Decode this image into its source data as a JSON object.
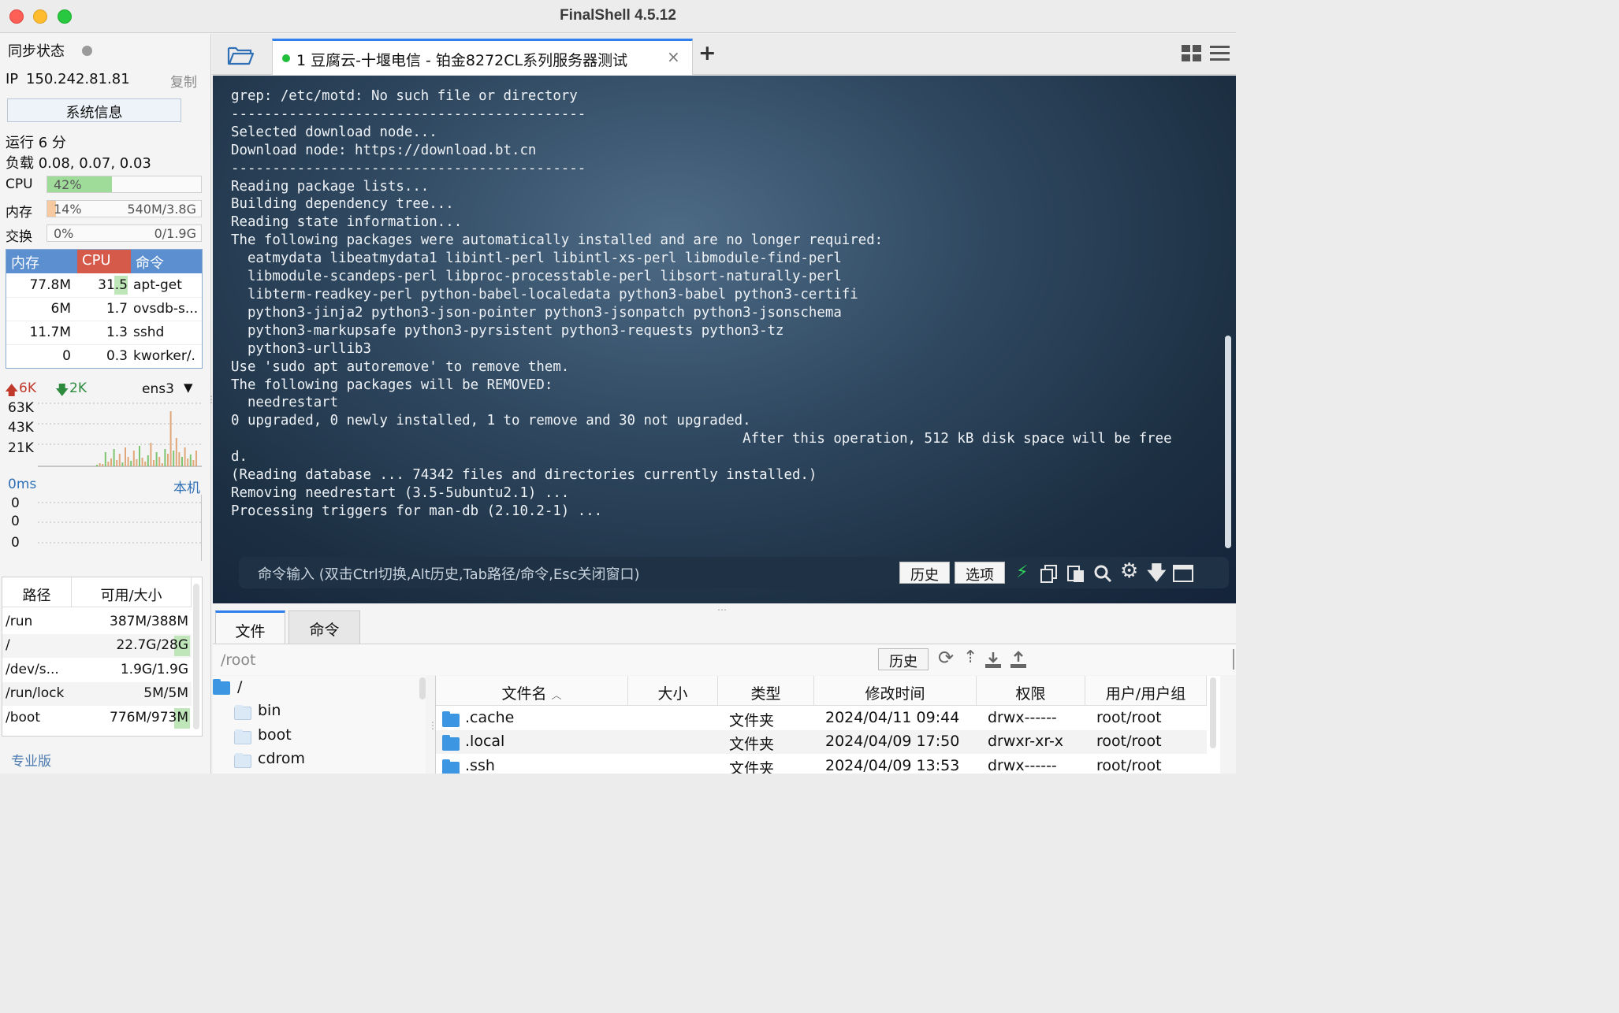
{
  "window": {
    "title": "FinalShell 4.5.12"
  },
  "sidebar": {
    "sync_status": "同步状态",
    "ip_label": "IP",
    "ip": "150.242.81.81",
    "copy_label": "复制",
    "sysinfo_button": "系统信息",
    "uptime": "运行 6 分",
    "load": "负载 0.08, 0.07, 0.03",
    "cpu": {
      "label": "CPU",
      "percent_text": "42%",
      "fraction": 0.42
    },
    "memory": {
      "label": "内存",
      "percent_text": "14%",
      "value": "540M/3.8G",
      "fraction": 0.14
    },
    "swap": {
      "label": "交换",
      "percent_text": "0%",
      "value": "0/1.9G",
      "fraction": 0
    },
    "process_table": {
      "headers": [
        "内存",
        "CPU",
        "命令"
      ],
      "rows": [
        {
          "mem": "77.8M",
          "cpu": "31.5",
          "cmd": "apt-get"
        },
        {
          "mem": "6M",
          "cpu": "1.7",
          "cmd": "ovsdb-s..."
        },
        {
          "mem": "11.7M",
          "cpu": "1.3",
          "cmd": "sshd"
        },
        {
          "mem": "0",
          "cpu": "0.3",
          "cmd": "kworker/."
        }
      ]
    },
    "network": {
      "up": "6K",
      "down": "2K",
      "interface": "ens3",
      "y_labels": [
        "63K",
        "43K",
        "21K"
      ]
    },
    "latency": {
      "value": "0ms",
      "target": "本机",
      "y_labels": [
        "0",
        "0",
        "0"
      ]
    },
    "disk_table": {
      "headers": [
        "路径",
        "可用/大小"
      ],
      "rows": [
        {
          "path": "/run",
          "size": "387M/388M"
        },
        {
          "path": "/",
          "size": "22.7G/28G"
        },
        {
          "path": "/dev/s...",
          "size": "1.9G/1.9G"
        },
        {
          "path": "/run/lock",
          "size": "5M/5M"
        },
        {
          "path": "/boot",
          "size": "776M/973M"
        }
      ]
    },
    "edition": "专业版"
  },
  "tabs": [
    {
      "label": "1 豆腐云-十堰电信 - 铂金8272CL系列服务器测试",
      "status_color": "#1fbf3a"
    }
  ],
  "terminal": {
    "lines": [
      "grep: /etc/motd: No such file or directory",
      "-------------------------------------------",
      "Selected download node...",
      "Download node: https://download.bt.cn",
      "-------------------------------------------",
      "Reading package lists...",
      "Building dependency tree...",
      "Reading state information...",
      "The following packages were automatically installed and are no longer required:",
      "  eatmydata libeatmydata1 libintl-perl libintl-xs-perl libmodule-find-perl",
      "  libmodule-scandeps-perl libproc-processtable-perl libsort-naturally-perl",
      "  libterm-readkey-perl python-babel-localedata python3-babel python3-certifi",
      "  python3-jinja2 python3-json-pointer python3-jsonpatch python3-jsonschema",
      "  python3-markupsafe python3-pyrsistent python3-requests python3-tz",
      "  python3-urllib3",
      "Use 'sudo apt autoremove' to remove them.",
      "The following packages will be REMOVED:",
      "  needrestart",
      "0 upgraded, 0 newly installed, 1 to remove and 30 not upgraded.",
      "                                                              After this operation, 512 kB disk space will be free",
      "d.",
      "(Reading database ... 74342 files and directories currently installed.)",
      "Removing needrestart (3.5-5ubuntu2.1) ...",
      "Processing triggers for man-db (2.10.2-1) ..."
    ],
    "command_placeholder": "命令输入 (双击Ctrl切换,Alt历史,Tab路径/命令,Esc关闭窗口)",
    "history_button": "历史",
    "options_button": "选项"
  },
  "bottom": {
    "tabs": [
      "文件",
      "命令"
    ],
    "path": "/root",
    "history_button": "历史",
    "tree": [
      {
        "name": "/"
      },
      {
        "name": "bin"
      },
      {
        "name": "boot"
      },
      {
        "name": "cdrom"
      }
    ],
    "file_table": {
      "headers": [
        "文件名",
        "大小",
        "类型",
        "修改时间",
        "权限",
        "用户/用户组"
      ],
      "rows": [
        {
          "name": ".cache",
          "size": "",
          "type": "文件夹",
          "mtime": "2024/04/11 09:44",
          "perm": "drwx------",
          "owner": "root/root"
        },
        {
          "name": ".local",
          "size": "",
          "type": "文件夹",
          "mtime": "2024/04/09 17:50",
          "perm": "drwxr-xr-x",
          "owner": "root/root"
        },
        {
          "name": ".ssh",
          "size": "",
          "type": "文件夹",
          "mtime": "2024/04/09 13:53",
          "perm": "drwx------",
          "owner": "root/root"
        }
      ]
    }
  }
}
